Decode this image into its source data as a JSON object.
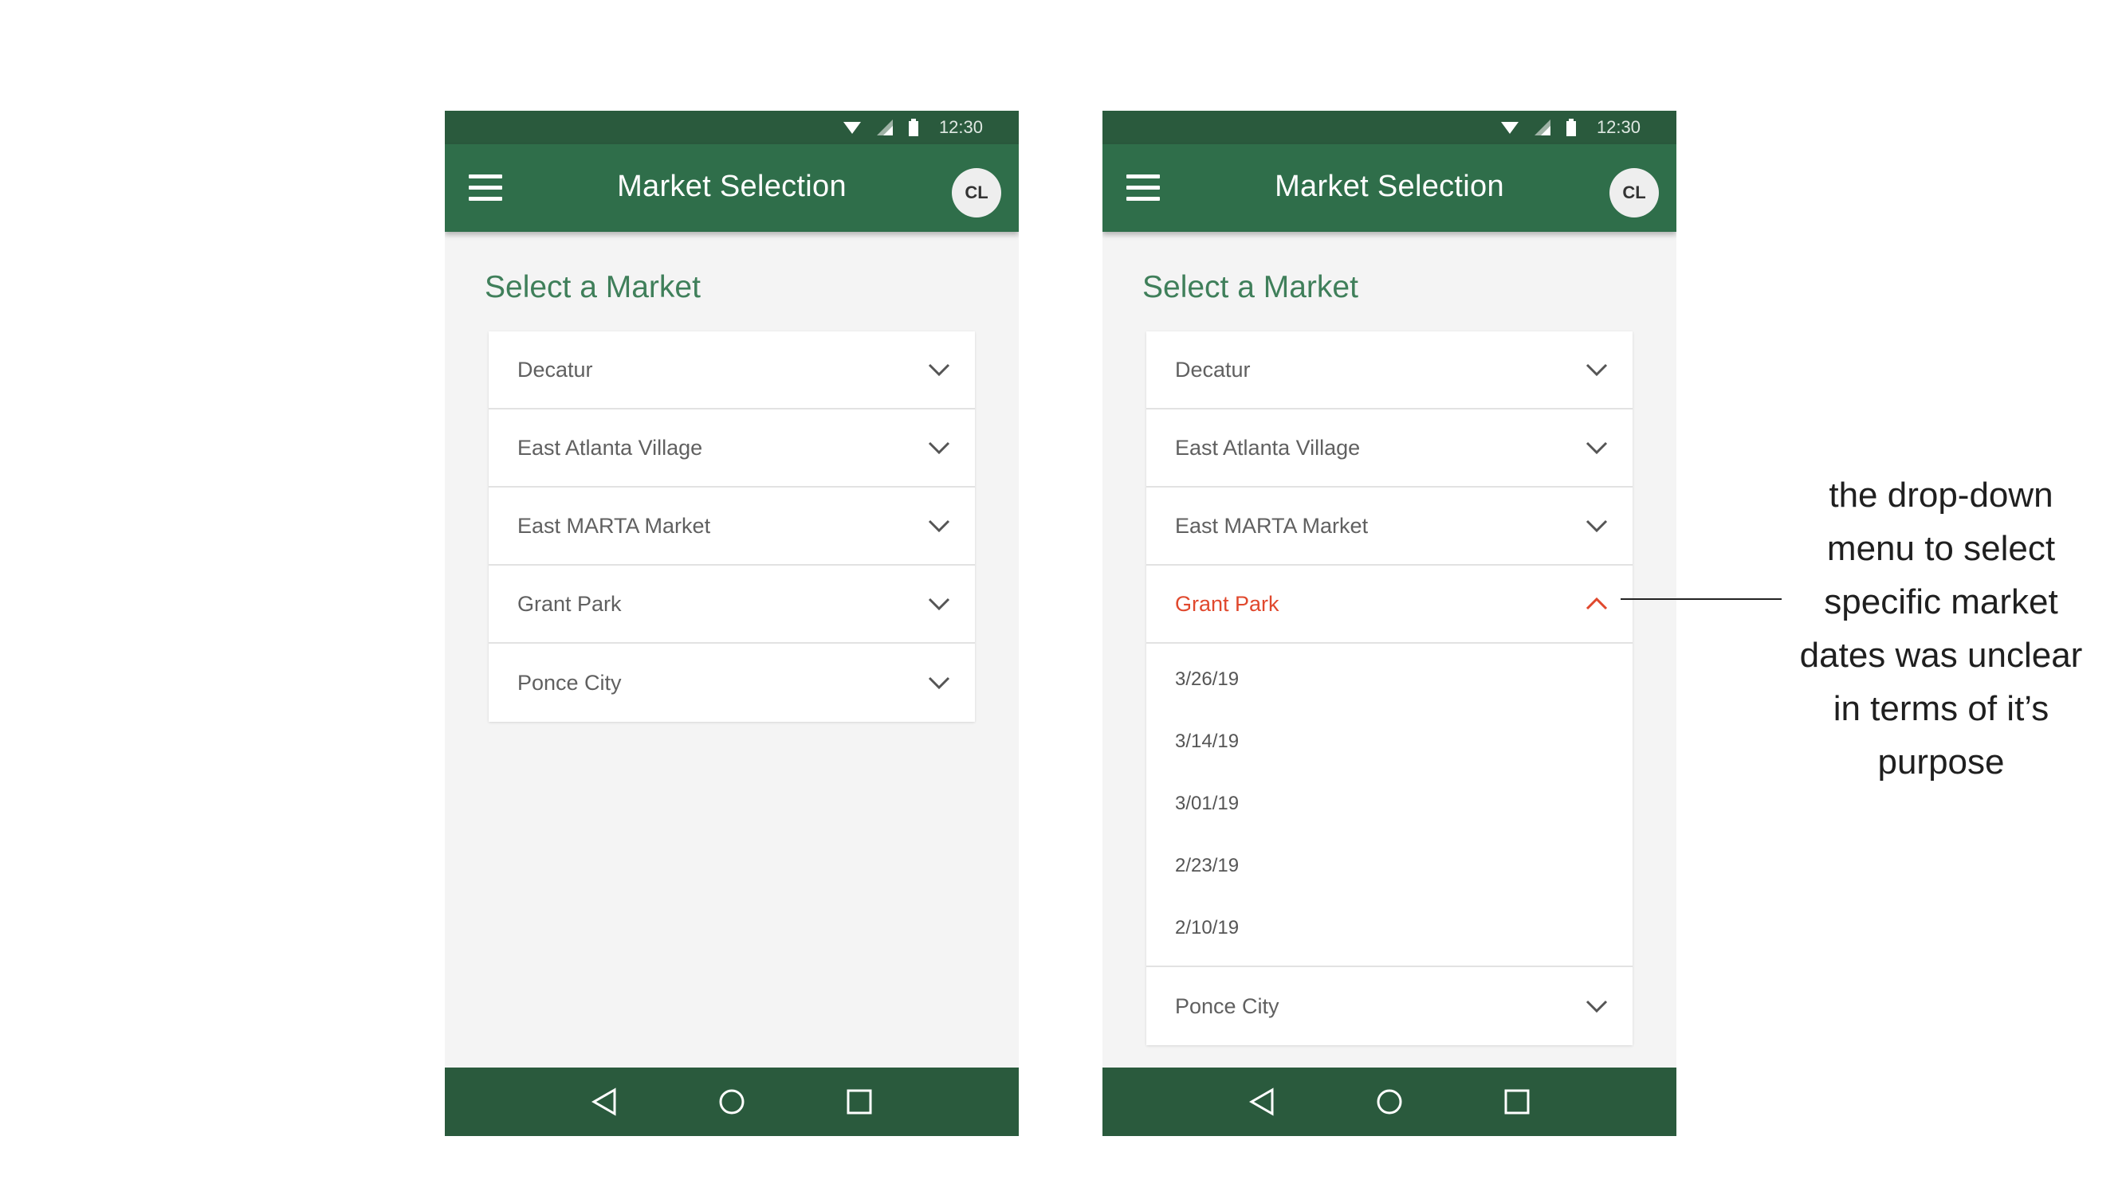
{
  "screens": [
    {
      "status": {
        "time": "12:30"
      },
      "app_bar": {
        "title": "Market Selection",
        "avatar_initials": "CL"
      },
      "section_title": "Select a Market",
      "markets": [
        {
          "label": "Decatur",
          "expanded": false
        },
        {
          "label": "East Atlanta Village",
          "expanded": false
        },
        {
          "label": "East MARTA Market",
          "expanded": false
        },
        {
          "label": "Grant Park",
          "expanded": false
        },
        {
          "label": "Ponce City",
          "expanded": false
        }
      ]
    },
    {
      "status": {
        "time": "12:30"
      },
      "app_bar": {
        "title": "Market Selection",
        "avatar_initials": "CL"
      },
      "section_title": "Select a Market",
      "markets": [
        {
          "label": "Decatur",
          "expanded": false
        },
        {
          "label": "East Atlanta Village",
          "expanded": false
        },
        {
          "label": "East MARTA Market",
          "expanded": false
        },
        {
          "label": "Grant Park",
          "expanded": true
        },
        {
          "label": "Ponce City",
          "expanded": false
        }
      ],
      "dates": [
        "3/26/19",
        "3/14/19",
        "3/01/19",
        "2/23/19",
        "2/10/19"
      ]
    }
  ],
  "annotation": {
    "lines": [
      "the drop-down",
      "menu to select",
      "specific market",
      "dates was unclear",
      "in terms of it’s",
      "purpose"
    ]
  },
  "colors": {
    "status_bar": "#2a5a3d",
    "app_bar": "#2f6e4a",
    "accent_green": "#3f7f5a",
    "active_red": "#e0482d"
  },
  "icons": {
    "menu": "hamburger-menu-icon",
    "expand": "chevron-down-icon",
    "collapse": "chevron-up-icon",
    "back": "back-triangle-icon",
    "home": "home-circle-icon",
    "recents": "recents-square-icon"
  }
}
